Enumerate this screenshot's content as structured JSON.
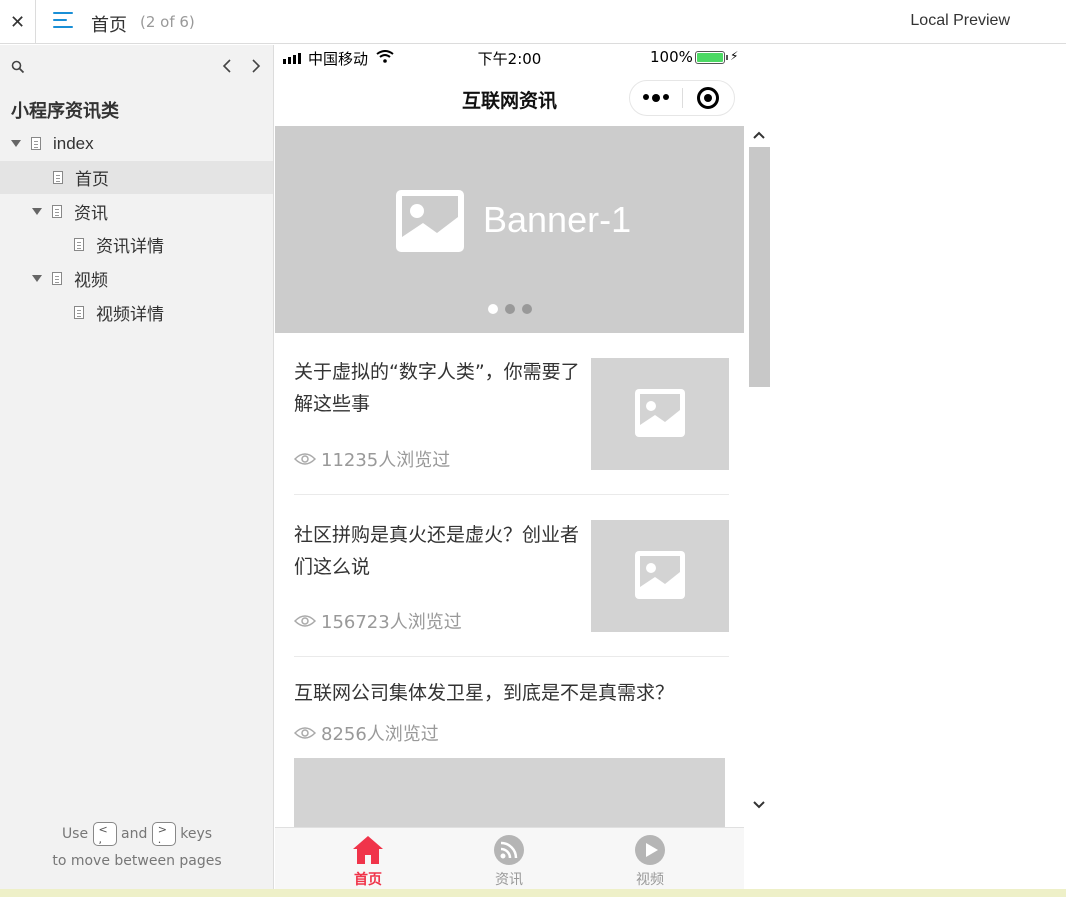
{
  "topbar": {
    "close_label": "✕",
    "title": "首页",
    "page_count": "(2 of 6)",
    "preview_label": "Local Preview"
  },
  "sidebar": {
    "project_title": "小程序资讯类",
    "items": [
      {
        "label": "index"
      },
      {
        "label": "首页"
      },
      {
        "label": "资讯"
      },
      {
        "label": "资讯详情"
      },
      {
        "label": "视频"
      },
      {
        "label": "视频详情"
      }
    ],
    "hint": {
      "use": "Use",
      "key_prev": "<\n,",
      "and": "and",
      "key_next": ">\n.",
      "keys": "keys",
      "line2": "to move between pages"
    }
  },
  "phone": {
    "status": {
      "carrier": "中国移动",
      "time": "下午2:00",
      "battery": "100%"
    },
    "navbar_title": "互联网资讯",
    "banner": {
      "text": "Banner-1",
      "dots_count": 3,
      "active_dot": 0
    },
    "news": [
      {
        "title": "关于虚拟的“数字人类”，你需要了解这些事",
        "views": "11235人浏览过"
      },
      {
        "title": "社区拼购是真火还是虚火？创业者们这么说",
        "views": "156723人浏览过"
      },
      {
        "title": "互联网公司集体发卫星，到底是不是真需求？",
        "views": "8256人浏览过"
      }
    ],
    "tabs": [
      {
        "label": "首页",
        "icon": "home-icon",
        "active": true
      },
      {
        "label": "资讯",
        "icon": "rss-icon",
        "active": false
      },
      {
        "label": "视频",
        "icon": "play-icon",
        "active": false
      }
    ]
  },
  "colors": {
    "accent_blue": "#1a8fd6",
    "tab_active": "#f0344a",
    "tab_inactive": "#999999",
    "placeholder_gray": "#cccccc"
  }
}
